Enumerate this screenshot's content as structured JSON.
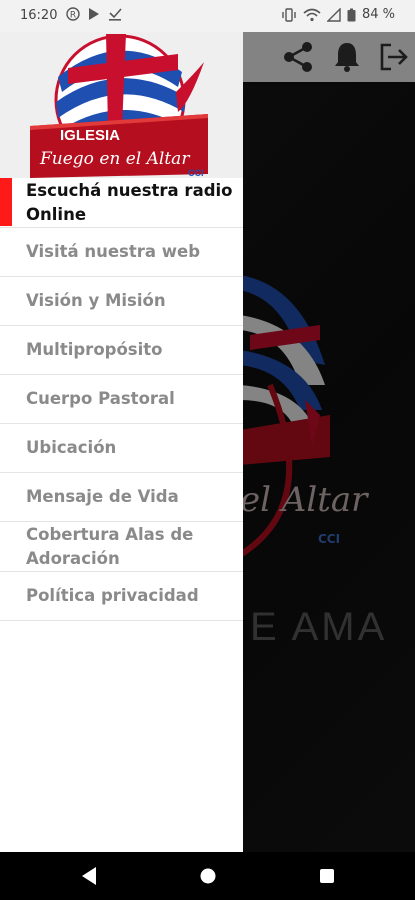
{
  "status_bar": {
    "time": "16:20",
    "battery_percent": "84 %",
    "icons_left": [
      "badge-r-icon",
      "play-store-icon",
      "download-done-icon"
    ],
    "icons_right": [
      "vibrate-icon",
      "wifi-icon",
      "signal-icon",
      "battery-icon"
    ]
  },
  "header": {
    "icons": [
      "share-icon",
      "bell-icon",
      "exit-icon"
    ]
  },
  "logo": {
    "top_text": "IGLESIA",
    "script_text": "Fuego en el Altar",
    "org": "CCI"
  },
  "menu": {
    "items": [
      {
        "label": "Escuchá nuestra radio Online",
        "active": true
      },
      {
        "label": "Visitá nuestra web",
        "active": false
      },
      {
        "label": "Visión y Misión",
        "active": false
      },
      {
        "label": "Multipropósito",
        "active": false
      },
      {
        "label": "Cuerpo Pastoral",
        "active": false
      },
      {
        "label": "Ubicación",
        "active": false
      },
      {
        "label": "Mensaje de Vida",
        "active": false
      },
      {
        "label": "Cobertura Alas de Adoración",
        "active": false
      },
      {
        "label": "Política privacidad",
        "active": false
      }
    ]
  },
  "background": {
    "script_text": "el Altar",
    "org": "CCI",
    "slogan": "E AMA"
  },
  "navigation_bar": {
    "buttons": [
      "back-icon",
      "home-icon",
      "recents-icon"
    ]
  },
  "colors": {
    "accent_red": "#ff1a1a",
    "logo_blue": "#1f4fb0",
    "logo_red": "#c8102e"
  }
}
